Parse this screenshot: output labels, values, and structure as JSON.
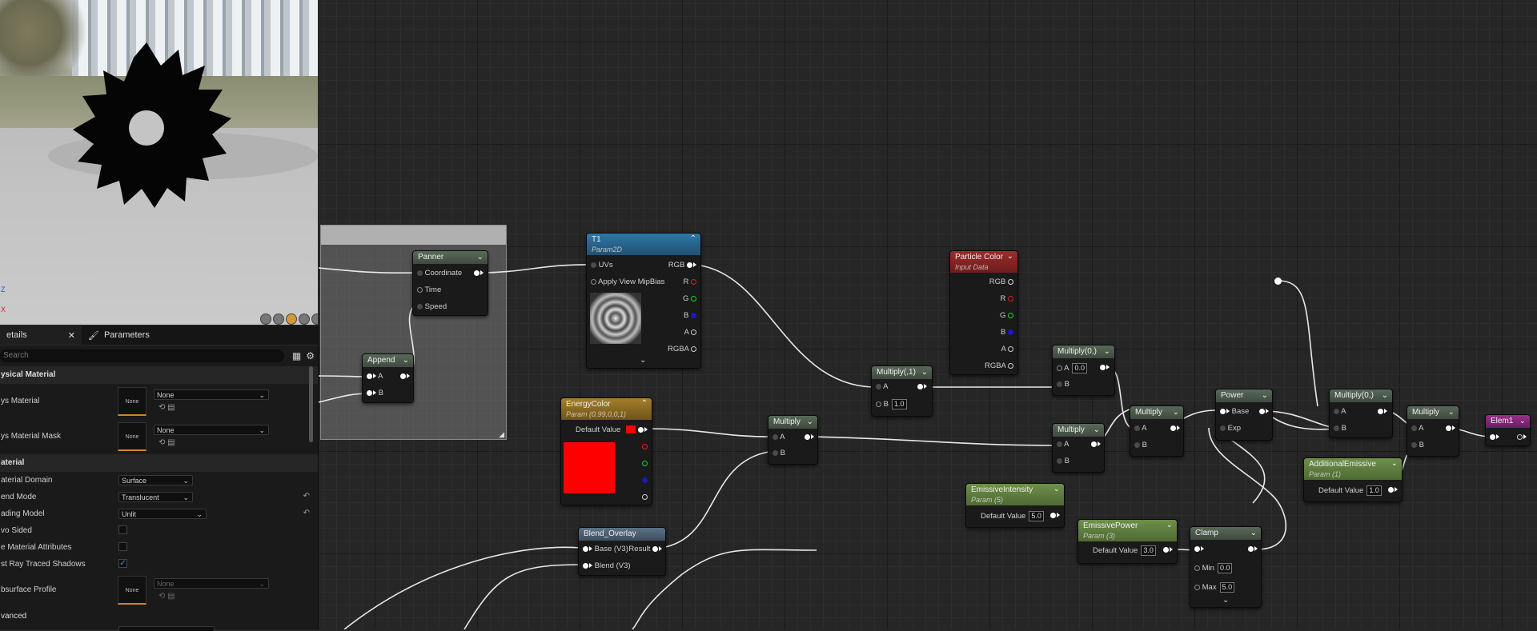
{
  "details": {
    "tabs": [
      {
        "label": "etails",
        "icon": "close-icon"
      },
      {
        "label": "Parameters",
        "icon": "brush-icon"
      }
    ],
    "search_placeholder": "Search",
    "sections": {
      "physical": "ysical Material",
      "material": "aterial",
      "advanced": "vanced"
    },
    "rows": {
      "phys_material": {
        "label": "ys Material",
        "thumb": "None",
        "value": "None"
      },
      "phys_mask": {
        "label": "ys Material Mask",
        "thumb": "None",
        "value": "None"
      },
      "domain": {
        "label": "aterial Domain",
        "value": "Surface"
      },
      "blend": {
        "label": "end Mode",
        "value": "Translucent"
      },
      "shading": {
        "label": "ading Model",
        "value": "Unlit"
      },
      "two_sided": {
        "label": "vo Sided",
        "checked": false
      },
      "use_attr": {
        "label": "e Material Attributes",
        "checked": false
      },
      "raytraced": {
        "label": "st Ray Traced Shadows",
        "checked": true
      },
      "subsurface": {
        "label": "bsurface Profile",
        "thumb": "None",
        "value": "None"
      }
    }
  },
  "viewport": {
    "axis_z": "Z",
    "axis_x": "X"
  },
  "graph": {
    "panner": {
      "title": "Panner",
      "pins": [
        "Coordinate",
        "Time",
        "Speed"
      ]
    },
    "append": {
      "title": "Append",
      "pins": [
        "A",
        "B"
      ]
    },
    "t1": {
      "title": "T1",
      "subtitle": "Param2D",
      "inputs": [
        "UVs",
        "Apply View MipBias"
      ],
      "outputs": [
        "RGB",
        "R",
        "G",
        "B",
        "A",
        "RGBA"
      ]
    },
    "multiply1": {
      "title": "Multiply(,1)",
      "a": "A",
      "b": "B",
      "b_value": "1.0"
    },
    "particle": {
      "title": "Particle Color",
      "subtitle": "Input Data",
      "outputs": [
        "RGB",
        "R",
        "G",
        "B",
        "A",
        "RGBA"
      ]
    },
    "energy": {
      "title": "EnergyColor",
      "subtitle": "Param (0.99,0,0,1)",
      "default_label": "Default Value"
    },
    "multiply_a": {
      "title": "Multiply",
      "a": "A",
      "b": "B"
    },
    "blend_overlay": {
      "title": "Blend_Overlay",
      "base": "Base (V3)",
      "blend": "Blend (V3)",
      "result": "Result"
    },
    "multiply0": {
      "title": "Multiply(0,)",
      "a": "A",
      "a_value": "0.0",
      "b": "B"
    },
    "multiply_b": {
      "title": "Multiply",
      "a": "A",
      "b": "B"
    },
    "multiply_c": {
      "title": "Multiply",
      "a": "A",
      "b": "B"
    },
    "power": {
      "title": "Power",
      "base": "Base",
      "exp": "Exp"
    },
    "emissive_intensity": {
      "title": "EmissiveIntensity",
      "subtitle": "Param (5)",
      "default_label": "Default Value",
      "value": "5.0"
    },
    "emissive_power": {
      "title": "EmissivePower",
      "subtitle": "Param (3)",
      "default_label": "Default Value",
      "value": "3.0"
    },
    "clamp": {
      "title": "Clamp",
      "min": "Min",
      "min_value": "0.0",
      "max": "Max",
      "max_value": "5.0"
    },
    "multiply0b": {
      "title": "Multiply(0,)",
      "a": "A",
      "b": "B"
    },
    "additional": {
      "title": "AdditionalEmissive",
      "subtitle": "Param (1)",
      "default_label": "Default Value",
      "value": "1.0"
    },
    "multiply_d": {
      "title": "Multiply",
      "a": "A",
      "b": "B"
    },
    "elem": {
      "title": "Elem1"
    }
  }
}
